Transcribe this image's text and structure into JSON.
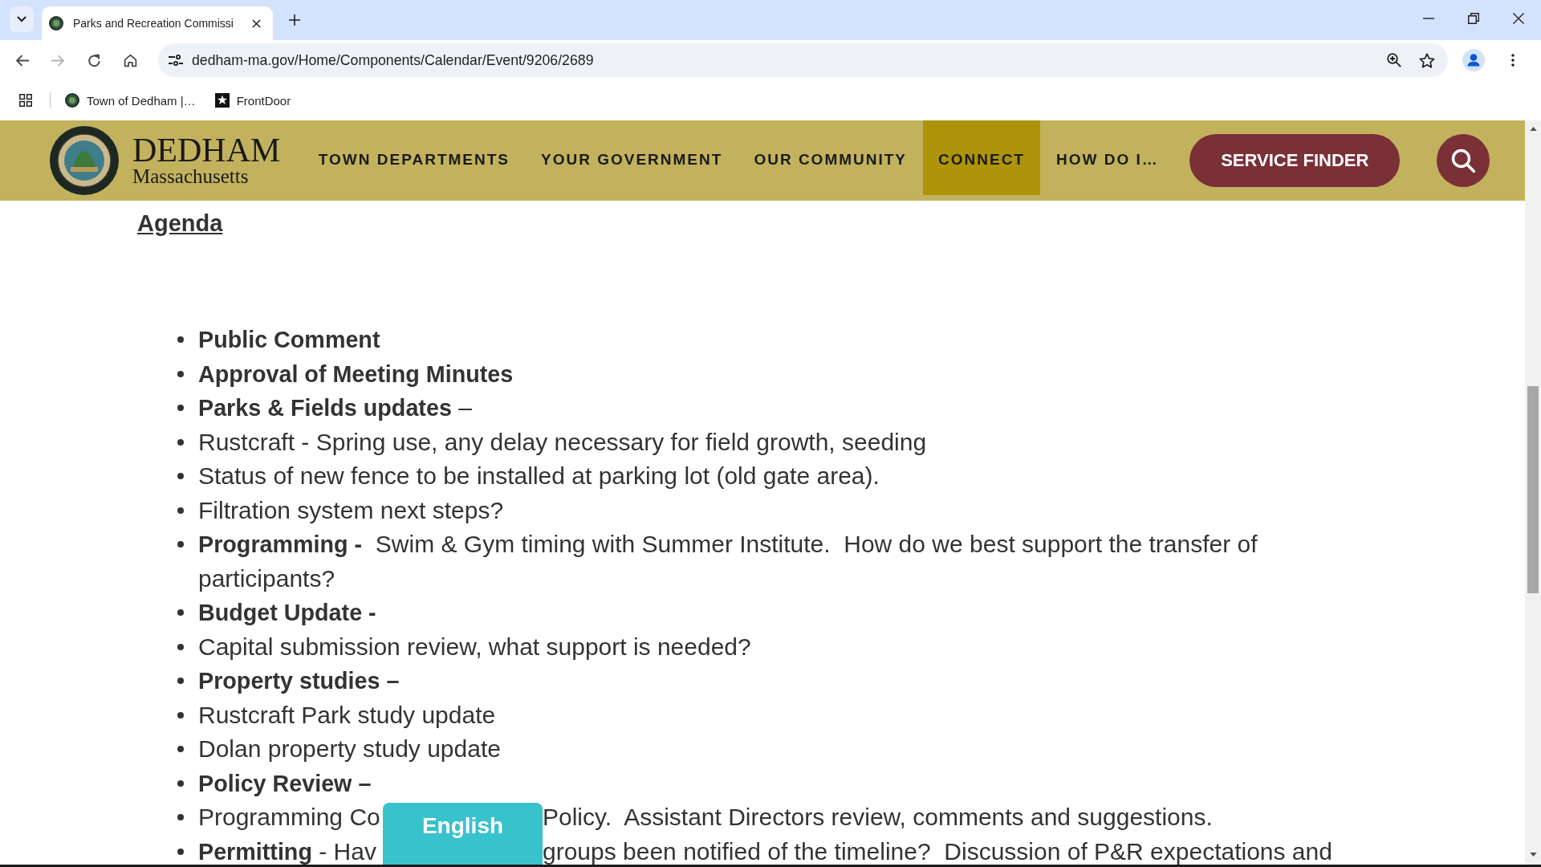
{
  "browser": {
    "tabs": [
      {
        "title": "Parks and Recreation Commissi",
        "selected": true
      }
    ],
    "forward_disabled": true,
    "url": "dedham-ma.gov/Home/Components/Calendar/Event/9206/2689",
    "bookmarks": [
      {
        "label": "Town of Dedham |…",
        "kind": "site"
      },
      {
        "label": "FrontDoor",
        "kind": "app"
      }
    ]
  },
  "site_header": {
    "logo_title": "DEDHAM",
    "logo_subtitle": "Massachusetts",
    "nav": [
      {
        "label": "TOWN DEPARTMENTS",
        "selected": false
      },
      {
        "label": "YOUR GOVERNMENT",
        "selected": false
      },
      {
        "label": "OUR COMMUNITY",
        "selected": false
      },
      {
        "label": "CONNECT",
        "selected": true
      },
      {
        "label": "HOW DO I…",
        "selected": false
      }
    ],
    "service_button": "SERVICE FINDER"
  },
  "agenda": {
    "heading": "Agenda",
    "items": [
      {
        "kind": "text",
        "text": "**Public Comment**"
      },
      {
        "kind": "text",
        "text": "**Approval of Meeting Minutes**"
      },
      {
        "kind": "text",
        "text": "**Parks & Fields updates** –"
      },
      {
        "kind": "text",
        "text": "Rustcraft - Spring use, any delay necessary for field growth, seeding"
      },
      {
        "kind": "text",
        "text": "Status of new fence to be installed at parking lot (old gate area)."
      },
      {
        "kind": "text",
        "text": "Filtration system next steps?"
      },
      {
        "kind": "text",
        "text": "**Programming -**  Swim & Gym timing with Summer Institute.  How do we best support the transfer of participants?"
      },
      {
        "kind": "text",
        "text": "**Budget Update -**"
      },
      {
        "kind": "text",
        "text": "Capital submission review, what support is needed?"
      },
      {
        "kind": "text",
        "text": "**Property studies –**"
      },
      {
        "kind": "text",
        "text": "Rustcraft Park study update"
      },
      {
        "kind": "text",
        "text": "Dolan property study update"
      },
      {
        "kind": "text",
        "text": "**Policy Review –**"
      },
      {
        "kind": "split",
        "text_before": "Programming Co",
        "text_after": "Policy.  Assistant Directors review, comments and suggestions."
      },
      {
        "kind": "split",
        "text_before": "**Permitting** - Hav",
        "text_after": "groups been notified of the timeline?  Discussion of P&R expectations and"
      }
    ]
  },
  "language_button": "English"
}
